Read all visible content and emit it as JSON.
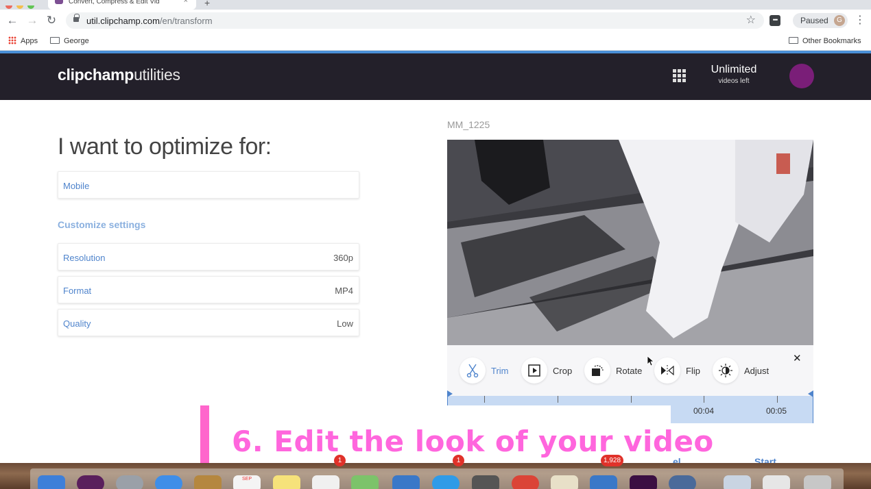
{
  "browser": {
    "tab_title": "Convert, Compress & Edit Vid",
    "url_host": "util.clipchamp.com",
    "url_path": "/en/transform",
    "profile_status": "Paused",
    "profile_initial": "G",
    "bookmarks": {
      "apps": "Apps",
      "george": "George",
      "other": "Other Bookmarks"
    }
  },
  "app": {
    "logo_bold": "clipchamp",
    "logo_light": "utilities",
    "plan_title": "Unlimited",
    "plan_subtitle": "videos left",
    "colors": {
      "accent": "#4f84cc",
      "header_bg": "#23202a",
      "avatar": "#7a1e78",
      "banner": "#ff66dd"
    }
  },
  "settings": {
    "heading": "I want to optimize for:",
    "optimize_value": "Mobile",
    "customize_label": "Customize settings",
    "rows": [
      {
        "label": "Resolution",
        "value": "360p"
      },
      {
        "label": "Format",
        "value": "MP4"
      },
      {
        "label": "Quality",
        "value": "Low"
      }
    ]
  },
  "video": {
    "filename": "MM_1225"
  },
  "tools": [
    {
      "label": "Trim",
      "icon": "scissors-icon",
      "active": true
    },
    {
      "label": "Crop",
      "icon": "crop-icon",
      "active": false
    },
    {
      "label": "Rotate",
      "icon": "rotate-icon",
      "active": false
    },
    {
      "label": "Flip",
      "icon": "flip-icon",
      "active": false
    },
    {
      "label": "Adjust",
      "icon": "adjust-icon",
      "active": false
    }
  ],
  "timeline": {
    "labels": [
      "00:04",
      "00:05"
    ]
  },
  "footer": {
    "left_link": "el",
    "right_link": "Start"
  },
  "banner": {
    "text": "6. Edit the look of your video"
  },
  "dock": {
    "badges": [
      "1",
      "1",
      "1,928"
    ],
    "calendar_month": "SEP"
  }
}
